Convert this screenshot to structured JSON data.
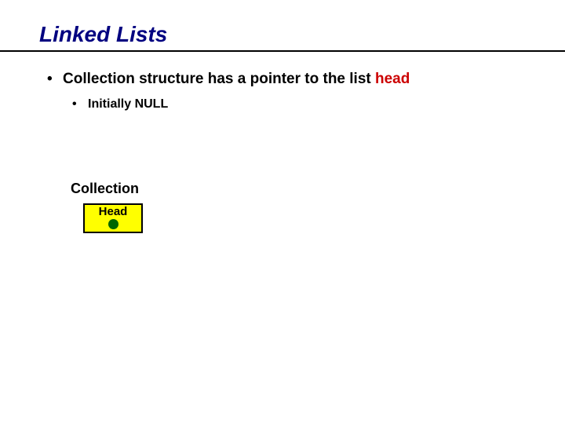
{
  "title": "Linked Lists",
  "bullets": {
    "level1_prefix": "Collection structure has a pointer to the list ",
    "level1_highlight": "head",
    "level2": "Initially NULL"
  },
  "diagram": {
    "collection_label": "Collection",
    "head_label": "Head"
  },
  "colors": {
    "title": "#000080",
    "highlight": "#cc0000",
    "head_box_bg": "#ffff00",
    "head_dot": "#006600"
  }
}
